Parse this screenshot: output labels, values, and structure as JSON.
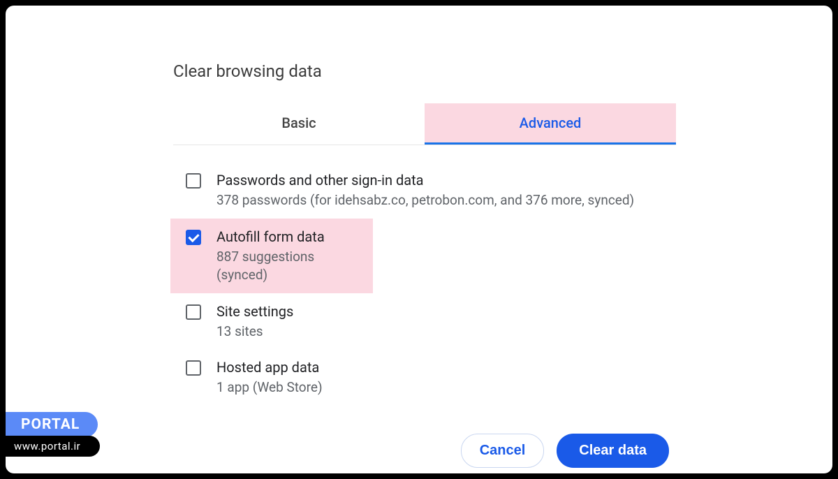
{
  "dialog": {
    "title": "Clear browsing data",
    "tabs": {
      "basic": "Basic",
      "advanced": "Advanced"
    },
    "options": {
      "passwords": {
        "label": "Passwords and other sign-in data",
        "sub": "378 passwords (for idehsabz.co, petrobon.com, and 376 more, synced)",
        "checked": false
      },
      "autofill": {
        "label": "Autofill form data",
        "sub": "887 suggestions (synced)",
        "checked": true
      },
      "site": {
        "label": "Site settings",
        "sub": "13 sites",
        "checked": false
      },
      "hosted": {
        "label": "Hosted app data",
        "sub": "1 app (Web Store)",
        "checked": false
      }
    },
    "actions": {
      "cancel": "Cancel",
      "clear": "Clear data"
    }
  },
  "watermark": {
    "brand": "PORTAL",
    "url": "www.portal.ir"
  }
}
